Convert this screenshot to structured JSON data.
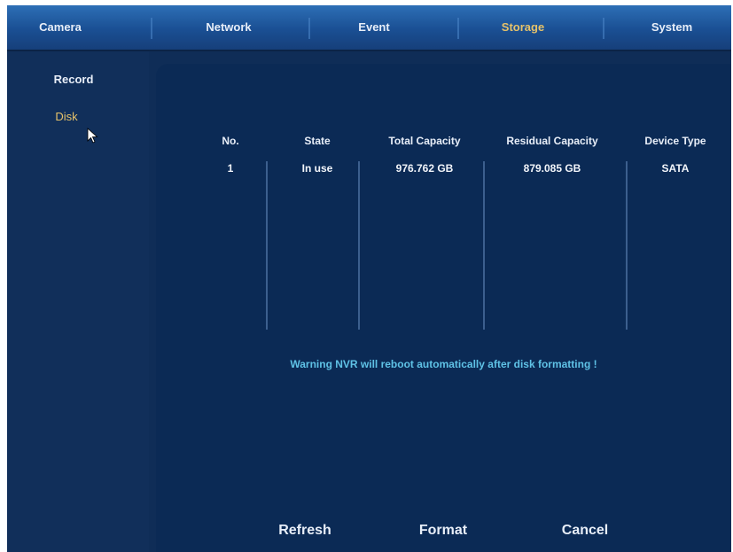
{
  "tabs": [
    {
      "label": "Camera"
    },
    {
      "label": "Network"
    },
    {
      "label": "Event"
    },
    {
      "label": "Storage",
      "active": true
    },
    {
      "label": "System"
    }
  ],
  "sidebar": {
    "items": [
      {
        "label": "Record"
      },
      {
        "label": "Disk",
        "active": true
      }
    ]
  },
  "disk_table": {
    "headers": [
      "No.",
      "State",
      "Total Capacity",
      "Residual Capacity",
      "Device Type"
    ],
    "rows": [
      [
        "1",
        "In use",
        "976.762 GB",
        "879.085 GB",
        "SATA"
      ]
    ]
  },
  "warning": "Warning NVR will reboot automatically after disk formatting !",
  "buttons": {
    "refresh": "Refresh",
    "format": "Format",
    "cancel": "Cancel"
  },
  "colors": {
    "background": "#0f2d57",
    "tab_bar": "#1a4f93",
    "active_text": "#e6c26a",
    "warning_text": "#5fc2e6"
  }
}
